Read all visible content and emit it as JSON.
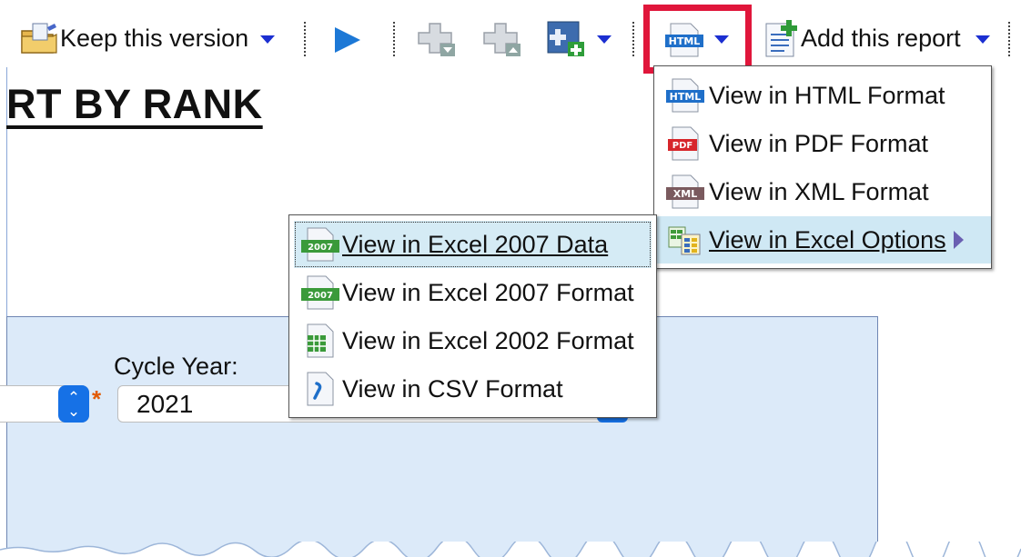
{
  "toolbar": {
    "keep_version_label": "Keep this version",
    "add_report_label": "Add this report",
    "html_icon_text": "HTML"
  },
  "report": {
    "heading": "RT BY RANK"
  },
  "prompt": {
    "cycle_year_label": "Cycle Year:",
    "cycle_year_value": "2021",
    "required_marker": "*"
  },
  "format_menu": {
    "items": [
      {
        "label": "View in HTML Format",
        "icon": "html-icon",
        "icon_text": "HTML"
      },
      {
        "label": "View in PDF Format",
        "icon": "pdf-icon",
        "icon_text": "PDF"
      },
      {
        "label": "View in XML Format",
        "icon": "xml-icon",
        "icon_text": "XML"
      },
      {
        "label": "View in Excel Options",
        "icon": "excel-options-icon"
      }
    ]
  },
  "excel_menu": {
    "items": [
      {
        "label": "View in Excel 2007 Data",
        "icon": "excel-2007-icon",
        "icon_text": "2007"
      },
      {
        "label": "View in Excel 2007 Format",
        "icon": "excel-2007-icon",
        "icon_text": "2007"
      },
      {
        "label": "View in Excel 2002 Format",
        "icon": "excel-2002-icon"
      },
      {
        "label": "View in CSV Format",
        "icon": "csv-icon"
      }
    ]
  },
  "colors": {
    "accent_blue": "#1b2fd1",
    "highlight_red": "#e0163b",
    "panel_bg": "#dceaf9",
    "menu_hover": "#cfe8f4"
  }
}
